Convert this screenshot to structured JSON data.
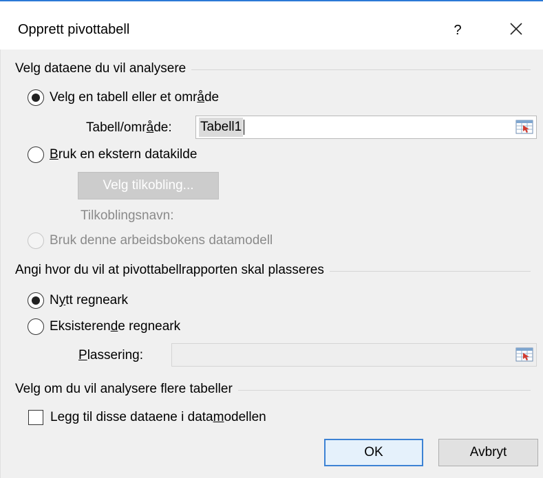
{
  "dialog": {
    "title": "Opprett pivottabell",
    "help_label": "?"
  },
  "section_data": {
    "heading": "Velg dataene du vil analysere",
    "option_table_pre": "Velg en tabell eller et omr",
    "option_table_ul": "å",
    "option_table_post": "de",
    "table_range_label_pre": "Tabell/omr",
    "table_range_label_ul": "å",
    "table_range_label_post": "de:",
    "table_range_value": "Tabell1",
    "option_external_ul": "B",
    "option_external_post": "ruk en ekstern datakilde",
    "choose_connection_button": "Velg tilkobling...",
    "connection_name_label": "Tilkoblingsnavn:",
    "option_datamodel": "Bruk denne arbeidsbokens datamodell"
  },
  "section_location": {
    "heading": "Angi hvor du vil at pivottabellrapporten skal plasseres",
    "option_new_pre": "N",
    "option_new_ul": "y",
    "option_new_post": "tt regneark",
    "option_existing_pre": "Eksisteren",
    "option_existing_ul": "d",
    "option_existing_post": "e regneark",
    "location_label_ul": "P",
    "location_label_post": "lassering:",
    "location_value": ""
  },
  "section_multi": {
    "heading": "Velg om du vil analysere flere tabeller",
    "checkbox_pre": "Legg til disse dataene i data",
    "checkbox_ul": "m",
    "checkbox_post": "odellen"
  },
  "buttons": {
    "ok": "OK",
    "cancel": "Avbryt"
  },
  "state": {
    "data_source": "table_or_range",
    "placement": "new_worksheet",
    "add_to_data_model": false
  },
  "colors": {
    "accent": "#2b79d6",
    "panel_background": "#f0f0f0",
    "default_button_border": "#3c82d4"
  }
}
